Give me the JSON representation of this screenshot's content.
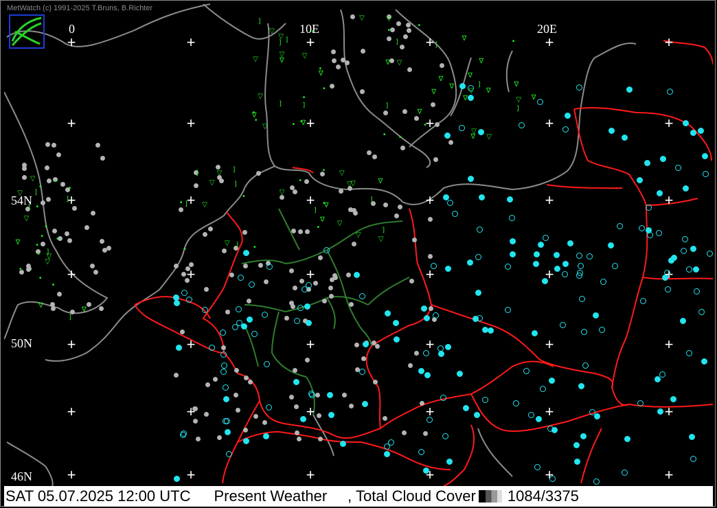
{
  "credit": "MetWatch  (c) 1991-2025 T.Bruns, B.Richter",
  "logo_icon": "metwatch-logo-icon",
  "grid_labels": {
    "lon_0": "0",
    "lon_10e": "10E",
    "lon_20e": "20E",
    "lat_54n": "54N",
    "lat_50n": "50N",
    "lat_46n": "46N"
  },
  "status": {
    "date_time": "SAT 05.07.2025 12:00 UTC",
    "layer1": "Present Weather",
    "layer2": ", Total Cloud Cover",
    "count": "1084/3375"
  },
  "colors": {
    "coastline": "#8c8c8c",
    "country_border": "#ff1a1a",
    "state_border": "#2f7d2f",
    "weather_symbol": "#22ee22",
    "cloud_symbol": "#22e5f0",
    "station_dot": "#b4b4b4",
    "grid_cross": "#ffffff"
  }
}
